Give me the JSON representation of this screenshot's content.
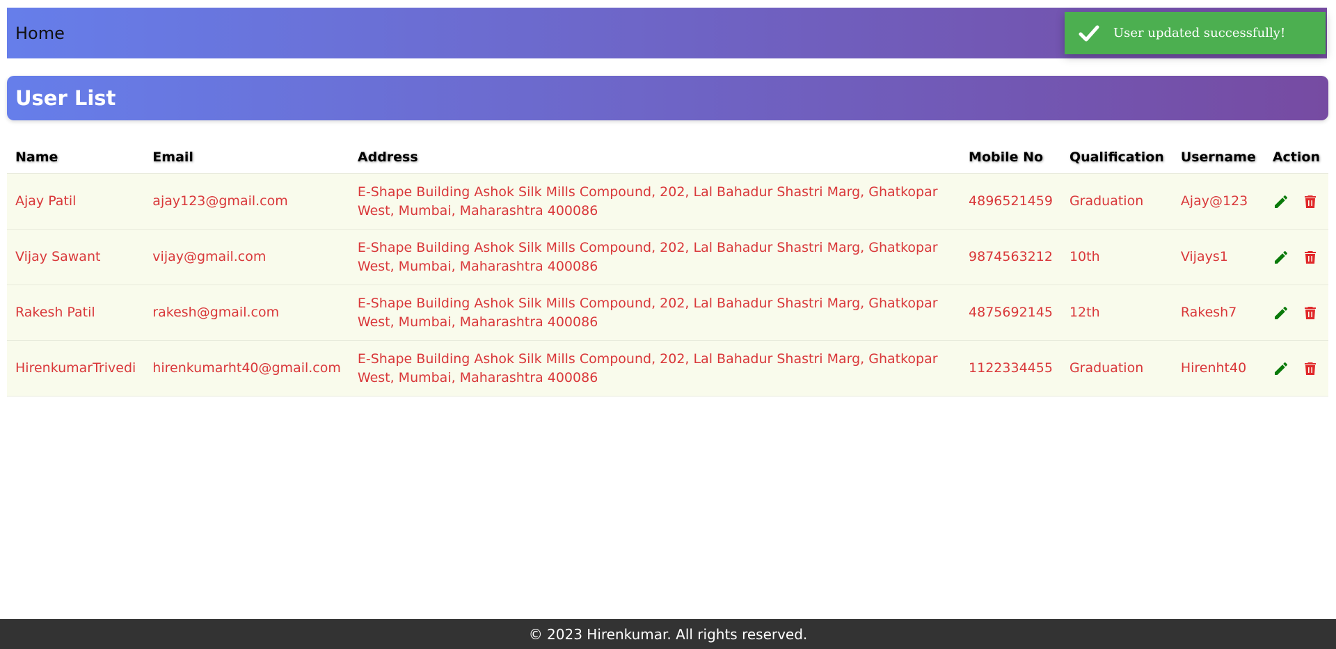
{
  "navbar": {
    "home_label": "Home",
    "gradient": [
      "#667eea",
      "#764ba2"
    ]
  },
  "toast": {
    "message": "User updated successfully!",
    "icon": "check-icon",
    "color": "#4caf50"
  },
  "page_title": "User List",
  "table": {
    "columns": [
      "Name",
      "Email",
      "Address",
      "Mobile No",
      "Qualification",
      "Username",
      "Action"
    ],
    "rows": [
      {
        "name": "Ajay Patil",
        "email": "ajay123@gmail.com",
        "address": "E-Shape Building Ashok Silk Mills Compound, 202, Lal Bahadur Shastri Marg, Ghatkopar West, Mumbai, Maharashtra 400086",
        "mobile": "4896521459",
        "qualification": "Graduation",
        "username": "Ajay@123"
      },
      {
        "name": "Vijay Sawant",
        "email": "vijay@gmail.com",
        "address": "E-Shape Building Ashok Silk Mills Compound, 202, Lal Bahadur Shastri Marg, Ghatkopar West, Mumbai, Maharashtra 400086",
        "mobile": "9874563212",
        "qualification": "10th",
        "username": "Vijays1"
      },
      {
        "name": "Rakesh Patil",
        "email": "rakesh@gmail.com",
        "address": "E-Shape Building Ashok Silk Mills Compound, 202, Lal Bahadur Shastri Marg, Ghatkopar West, Mumbai, Maharashtra 400086",
        "mobile": "4875692145",
        "qualification": "12th",
        "username": "Rakesh7"
      },
      {
        "name": "HirenkumarTrivedi",
        "email": "hirenkumarht40@gmail.com",
        "address": "E-Shape Building Ashok Silk Mills Compound, 202, Lal Bahadur Shastri Marg, Ghatkopar West, Mumbai, Maharashtra 400086",
        "mobile": "1122334455",
        "qualification": "Graduation",
        "username": "Hirenht40"
      }
    ],
    "row_text_color": "#d9383a",
    "row_background": "#f9fbec",
    "edit_icon": "pencil-icon",
    "edit_color": "#0a7a0a",
    "delete_icon": "trash-icon",
    "delete_color": "#e0282a"
  },
  "footer": {
    "text": "© 2023 Hirenkumar. All rights reserved.",
    "background": "#333333"
  }
}
